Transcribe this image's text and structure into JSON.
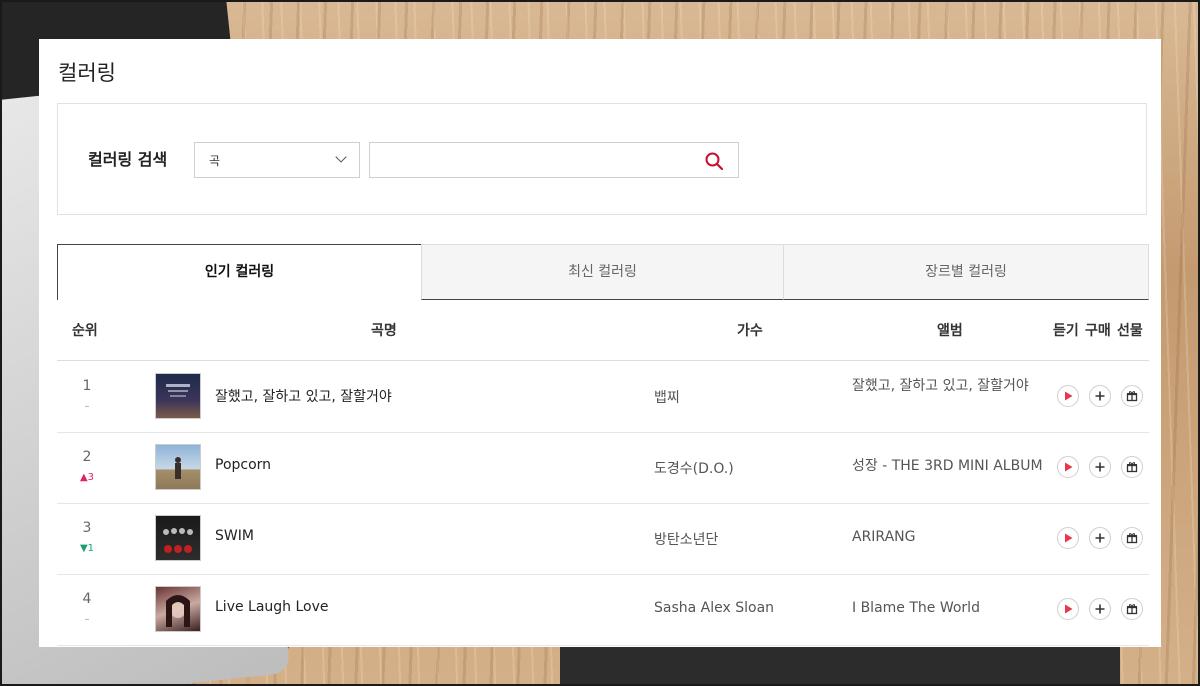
{
  "page": {
    "title": "컬러링"
  },
  "search": {
    "label": "컬러링 검색",
    "select_value": "곡",
    "input_placeholder": ""
  },
  "tabs": [
    {
      "label": "인기 컬러링",
      "active": true
    },
    {
      "label": "최신 컬러링",
      "active": false
    },
    {
      "label": "장르별 컬러링",
      "active": false
    }
  ],
  "table": {
    "headers": {
      "rank": "순위",
      "song": "곡명",
      "artist": "가수",
      "album": "앨범",
      "listen": "듣기",
      "buy": "구매",
      "gift": "선물"
    },
    "rows": [
      {
        "rank": "1",
        "change": "–",
        "change_dir": "same",
        "title": "잘했고, 잘하고 있고, 잘할거야",
        "artist": "뱁찌",
        "album": "잘했고, 잘하고 있고, 잘할거야"
      },
      {
        "rank": "2",
        "change": "3",
        "change_dir": "up",
        "title": "Popcorn",
        "artist": "도경수(D.O.)",
        "album": "성장 - THE 3RD MINI ALBUM"
      },
      {
        "rank": "3",
        "change": "1",
        "change_dir": "down",
        "title": "SWIM",
        "artist": "방탄소년단",
        "album": "ARIRANG"
      },
      {
        "rank": "4",
        "change": "–",
        "change_dir": "same",
        "title": "Live Laugh Love",
        "artist": "Sasha Alex Sloan",
        "album": "I Blame The World"
      }
    ]
  },
  "icons": {
    "search": "search-icon",
    "play": "play-icon",
    "add": "plus-icon",
    "gift": "gift-icon"
  },
  "colors": {
    "accent": "#c8102e",
    "up": "#e0245e",
    "down": "#1b9f6e"
  }
}
